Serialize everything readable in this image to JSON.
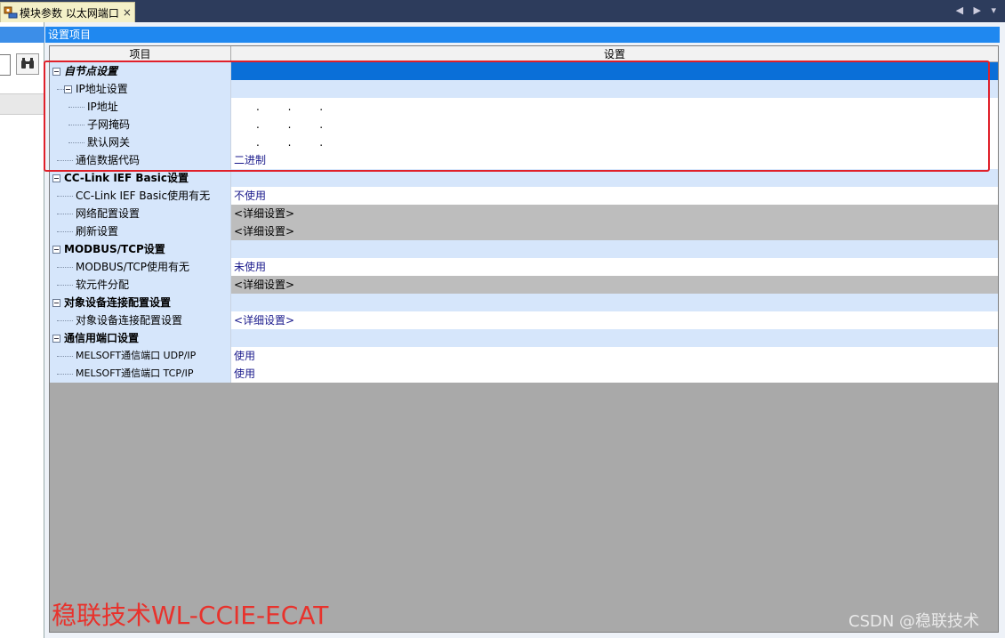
{
  "window": {
    "tab_title": "模块参数 以太网端口",
    "tab_close": "×",
    "nav_glyphs": "◀ ▶ ▾"
  },
  "left_pane": {
    "find_icon": "binoculars-icon"
  },
  "main": {
    "header": "设置项目",
    "columns": {
      "item": "项目",
      "setting": "设置"
    }
  },
  "rows": [
    {
      "label": "自节点设置",
      "value": ""
    },
    {
      "label": "IP地址设置",
      "value": ""
    },
    {
      "label": "IP地址",
      "value": ". . ."
    },
    {
      "label": "子网掩码",
      "value": ". . ."
    },
    {
      "label": "默认网关",
      "value": ". . ."
    },
    {
      "label": "通信数据代码",
      "value": "二进制"
    },
    {
      "label": "CC-Link IEF Basic设置",
      "value": ""
    },
    {
      "label": "CC-Link IEF Basic使用有无",
      "value": "不使用"
    },
    {
      "label": "网络配置设置",
      "value": "<详细设置>"
    },
    {
      "label": "刷新设置",
      "value": "<详细设置>"
    },
    {
      "label": "MODBUS/TCP设置",
      "value": ""
    },
    {
      "label": "MODBUS/TCP使用有无",
      "value": "未使用"
    },
    {
      "label": "软元件分配",
      "value": "<详细设置>"
    },
    {
      "label": "对象设备连接配置设置",
      "value": ""
    },
    {
      "label": "对象设备连接配置设置",
      "value": "<详细设置>"
    },
    {
      "label": "通信用端口设置",
      "value": ""
    },
    {
      "label": "MELSOFT通信端口 UDP/IP",
      "value": "使用"
    },
    {
      "label": "MELSOFT通信端口 TCP/IP",
      "value": "使用"
    }
  ],
  "watermarks": {
    "left": "稳联技术WL-CCIE-ECAT",
    "right": "CSDN @稳联技术"
  },
  "colors": {
    "selection": "#0a6fd8",
    "group_bg": "#d6e6fb",
    "highlight_box": "#e0202a"
  }
}
